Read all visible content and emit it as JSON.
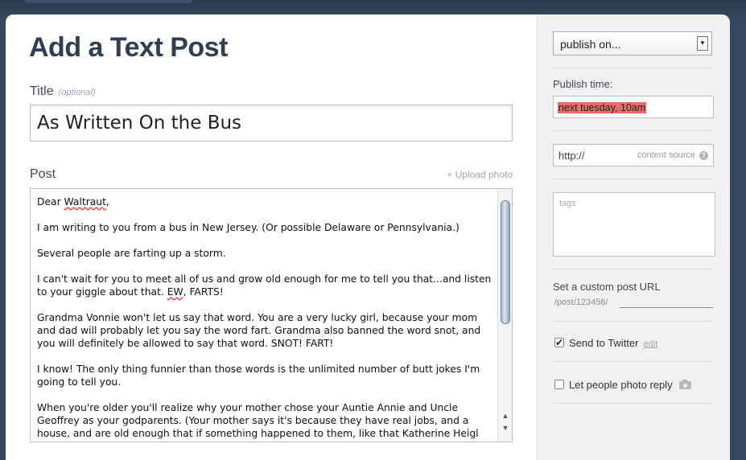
{
  "page": {
    "heading": "Add a Text Post"
  },
  "title_field": {
    "label": "Title",
    "hint": "(optional)",
    "value": "As Written On the Bus"
  },
  "post_field": {
    "label": "Post",
    "upload_link": "+ Upload photo",
    "greeting_word": "Dear ",
    "greeting_name": "Waltraut",
    "greeting_end": ",",
    "p1": "I am writing to you from a bus in New Jersey. (Or possible Delaware or Pennsylvania.)",
    "p2": "Several people are farting up a storm.",
    "p3_a": "I can't wait for you to meet all of us and grow old enough for me to tell you that...and listen to your giggle about that. ",
    "p3_ew": "EW",
    "p3_b": ", FARTS!",
    "p4": "Grandma Vonnie won't let us say that word. You are a very lucky girl, because your mom and dad will probably let you say the word fart. Grandma also banned the word snot, and you will definitely be allowed to say that word. SNOT! FART!",
    "p5": "I know! The only thing funnier than those words is the unlimited number of butt jokes I'm going to tell you.",
    "p6": "When you're older you'll realize why your mother chose your Auntie Annie and Uncle Geoffrey as your godparents. (Your mother says it's because they have real jobs, and a house, and are old enough that if something happened to them, like that Katherine Heigl"
  },
  "sidebar": {
    "publish_select": "publish on...",
    "publish_time_label": "Publish time:",
    "publish_time_value": "next tuesday, 10am",
    "source_value": "http://",
    "source_placeholder": "content source",
    "help_glyph": "?",
    "tags_placeholder": "tags",
    "custom_url_label": "Set a custom post URL",
    "custom_url_prefix": "/post/123456/",
    "twitter_label": "Send to Twitter",
    "twitter_edit": "edit",
    "twitter_checked": true,
    "photo_reply_label": "Let people photo reply",
    "photo_reply_checked": false
  },
  "colors": {
    "background": "#36465d",
    "heading": "#2f3e52",
    "time_highlight": "#f06a6a"
  }
}
